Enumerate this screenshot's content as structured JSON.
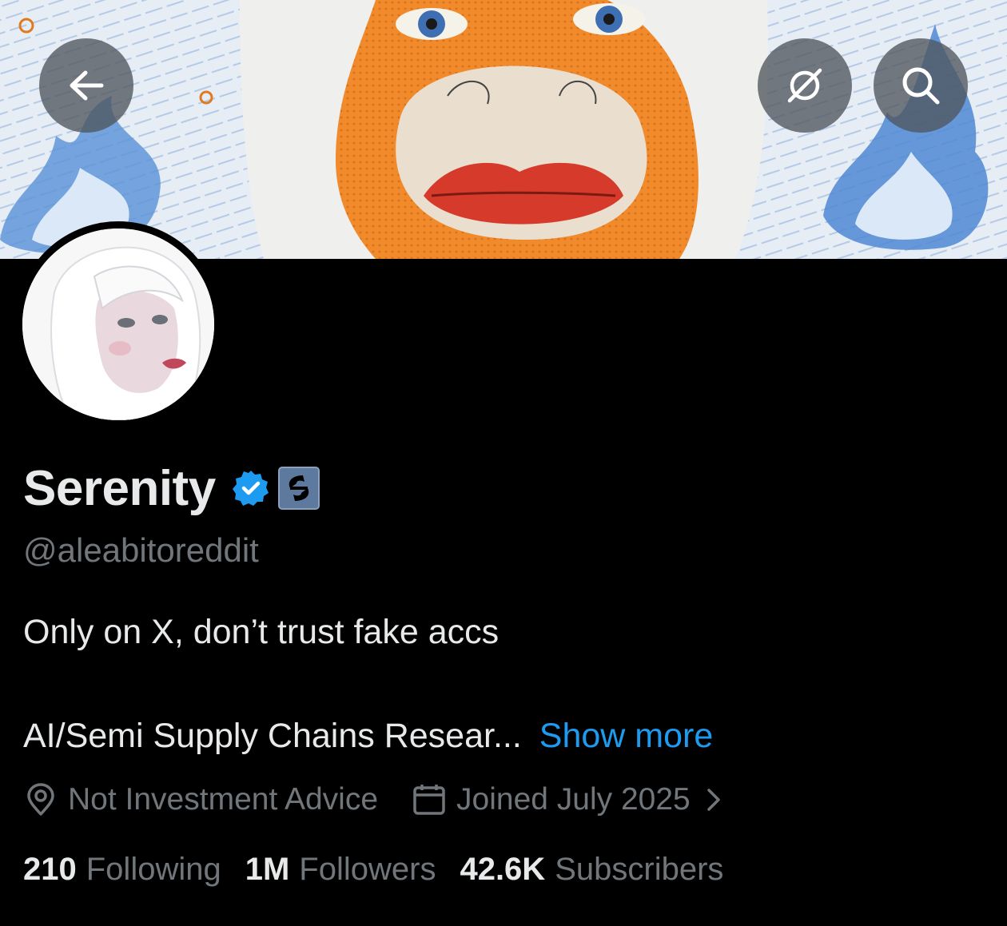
{
  "header": {
    "back_icon": "arrow-left-icon",
    "grok_icon": "grok-icon",
    "search_icon": "search-icon"
  },
  "profile": {
    "display_name": "Serenity",
    "handle": "@aleabitoreddit",
    "bio_line1": "Only on X, don’t trust fake accs",
    "bio_line2": "AI/Semi Supply Chains Resear...",
    "show_more": "Show more",
    "location": "Not Investment Advice",
    "joined": "Joined July 2025",
    "badges": [
      "verified-badge-icon",
      "affiliate-badge-icon"
    ]
  },
  "stats": {
    "following_count": "210",
    "following_label": "Following",
    "followers_count": "1M",
    "followers_label": "Followers",
    "subscribers_count": "42.6K",
    "subscribers_label": "Subscribers"
  },
  "colors": {
    "background": "#000000",
    "primary_text": "#e7e9ea",
    "secondary_text": "#71767b",
    "link": "#1d9bf0",
    "verified": "#1d9bf0"
  }
}
